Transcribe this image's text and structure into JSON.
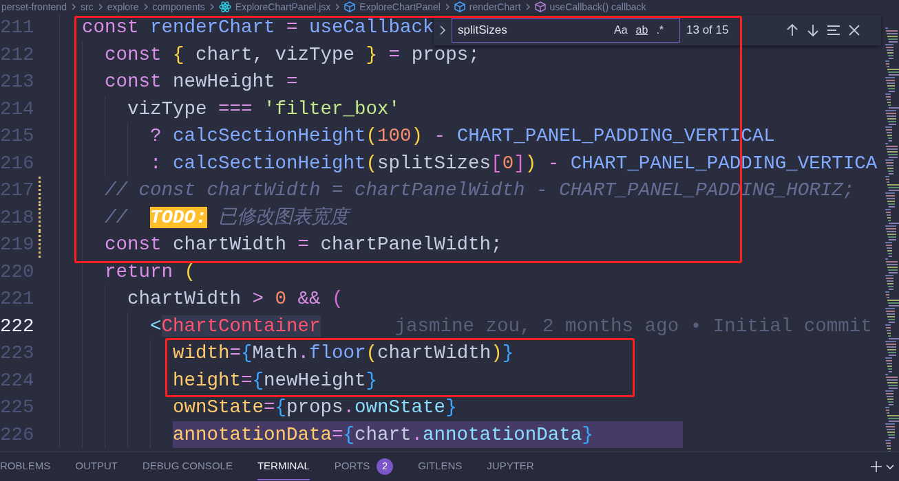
{
  "breadcrumbs": [
    {
      "label": "perset-frontend",
      "kind": "folder"
    },
    {
      "label": "src",
      "kind": "folder"
    },
    {
      "label": "explore",
      "kind": "folder"
    },
    {
      "label": "components",
      "kind": "folder"
    },
    {
      "label": "ExploreChartPanel.jsx",
      "kind": "file"
    },
    {
      "label": "ExploreChartPanel",
      "kind": "symbol"
    },
    {
      "label": "renderChart",
      "kind": "symbol"
    },
    {
      "label": "useCallback() callback",
      "kind": "method"
    }
  ],
  "find_widget": {
    "expanded": false,
    "value": "splitSizes",
    "options": [
      {
        "label": "Aa",
        "active": false
      },
      {
        "label": "ab",
        "active": false
      },
      {
        "label": ".*",
        "active": false
      }
    ],
    "result": "13 of 15"
  },
  "lines": [
    {
      "number": "211",
      "current": false,
      "modified": false,
      "selected": false,
      "tokens": [
        {
          "text": "  const ",
          "kind": "keyword"
        },
        {
          "text": "renderChart",
          "kind": "function"
        },
        {
          "text": " = ",
          "kind": "operator"
        },
        {
          "text": "useCallback",
          "kind": "function"
        }
      ]
    },
    {
      "number": "212",
      "current": false,
      "modified": false,
      "selected": false,
      "tokens": [
        {
          "text": "    const ",
          "kind": "keyword"
        },
        {
          "text": "{",
          "kind": "bracket1"
        },
        {
          "text": " chart, vizType ",
          "kind": "variable"
        },
        {
          "text": "}",
          "kind": "bracket1"
        },
        {
          "text": " = ",
          "kind": "operator"
        },
        {
          "text": "props;",
          "kind": "variable"
        }
      ]
    },
    {
      "number": "213",
      "current": false,
      "modified": false,
      "selected": false,
      "tokens": [
        {
          "text": "    const ",
          "kind": "keyword"
        },
        {
          "text": "newHeight",
          "kind": "variable"
        },
        {
          "text": " =",
          "kind": "operator"
        }
      ]
    },
    {
      "number": "214",
      "current": false,
      "modified": false,
      "selected": false,
      "tokens": [
        {
          "text": "      vizType",
          "kind": "variable"
        },
        {
          "text": " === ",
          "kind": "operator"
        },
        {
          "text": "'filter_box'",
          "kind": "string"
        }
      ]
    },
    {
      "number": "215",
      "current": false,
      "modified": false,
      "selected": false,
      "tokens": [
        {
          "text": "        ? ",
          "kind": "operator"
        },
        {
          "text": "calcSectionHeight",
          "kind": "function"
        },
        {
          "text": "(",
          "kind": "bracket1"
        },
        {
          "text": "100",
          "kind": "number"
        },
        {
          "text": ")",
          "kind": "bracket1"
        },
        {
          "text": " - ",
          "kind": "operator"
        },
        {
          "text": "CHART_PANEL_PADDING_VERTICAL",
          "kind": "constant"
        }
      ]
    },
    {
      "number": "216",
      "current": false,
      "modified": false,
      "selected": false,
      "tokens": [
        {
          "text": "        : ",
          "kind": "operator"
        },
        {
          "text": "calcSectionHeight",
          "kind": "function"
        },
        {
          "text": "(",
          "kind": "bracket1"
        },
        {
          "text": "splitSizes",
          "kind": "variable"
        },
        {
          "text": "[",
          "kind": "bracket2"
        },
        {
          "text": "0",
          "kind": "number"
        },
        {
          "text": "]",
          "kind": "bracket2"
        },
        {
          "text": ")",
          "kind": "bracket1"
        },
        {
          "text": " - ",
          "kind": "operator"
        },
        {
          "text": "CHART_PANEL_PADDING_VERTICA",
          "kind": "constant"
        }
      ]
    },
    {
      "number": "217",
      "current": false,
      "modified": true,
      "selected": false,
      "tokens": [
        {
          "text": "    // const chartWidth = chartPanelWidth - CHART_PANEL_PADDING_HORIZ;",
          "kind": "comment"
        }
      ]
    },
    {
      "number": "218",
      "current": false,
      "modified": true,
      "selected": false,
      "tokens": [
        {
          "text": "    //  ",
          "kind": "comment"
        },
        {
          "text": "TODO:",
          "kind": "todo"
        },
        {
          "text": " 已修改图表宽度",
          "kind": "comment"
        }
      ]
    },
    {
      "number": "219",
      "current": false,
      "modified": true,
      "selected": false,
      "tokens": [
        {
          "text": "    const ",
          "kind": "keyword"
        },
        {
          "text": "chartWidth",
          "kind": "variable"
        },
        {
          "text": " = ",
          "kind": "operator"
        },
        {
          "text": "chartPanelWidth;",
          "kind": "variable"
        }
      ]
    },
    {
      "number": "220",
      "current": false,
      "modified": false,
      "selected": false,
      "tokens": [
        {
          "text": "    return ",
          "kind": "keyword"
        },
        {
          "text": "(",
          "kind": "bracket1"
        }
      ]
    },
    {
      "number": "221",
      "current": false,
      "modified": false,
      "selected": false,
      "tokens": [
        {
          "text": "      chartWidth",
          "kind": "variable"
        },
        {
          "text": " > ",
          "kind": "operator"
        },
        {
          "text": "0",
          "kind": "number"
        },
        {
          "text": " && ",
          "kind": "operator"
        },
        {
          "text": "(",
          "kind": "bracket2"
        }
      ]
    },
    {
      "number": "222",
      "current": true,
      "modified": false,
      "selected": false,
      "tokens": [
        {
          "text": "        <",
          "kind": "jsx"
        },
        {
          "text": "ChartContainer",
          "kind": "tag"
        }
      ],
      "blame": "jasmine zou, 2 months ago • Initial commit"
    },
    {
      "number": "223",
      "current": false,
      "modified": false,
      "selected": false,
      "tokens": [
        {
          "text": "          width",
          "kind": "attribute"
        },
        {
          "text": "=",
          "kind": "operator"
        },
        {
          "text": "{",
          "kind": "bracket3"
        },
        {
          "text": "Math",
          "kind": "variable"
        },
        {
          "text": ".",
          "kind": "operator"
        },
        {
          "text": "floor",
          "kind": "function"
        },
        {
          "text": "(",
          "kind": "bracket1"
        },
        {
          "text": "chartWidth",
          "kind": "variable"
        },
        {
          "text": ")",
          "kind": "bracket1"
        },
        {
          "text": "}",
          "kind": "bracket3"
        }
      ]
    },
    {
      "number": "224",
      "current": false,
      "modified": false,
      "selected": false,
      "tokens": [
        {
          "text": "          height",
          "kind": "attribute"
        },
        {
          "text": "=",
          "kind": "operator"
        },
        {
          "text": "{",
          "kind": "bracket3"
        },
        {
          "text": "newHeight",
          "kind": "variable"
        },
        {
          "text": "}",
          "kind": "bracket3"
        }
      ]
    },
    {
      "number": "225",
      "current": false,
      "modified": false,
      "selected": false,
      "tokens": [
        {
          "text": "          ownState",
          "kind": "attribute"
        },
        {
          "text": "=",
          "kind": "operator"
        },
        {
          "text": "{",
          "kind": "bracket3"
        },
        {
          "text": "props",
          "kind": "variable"
        },
        {
          "text": ".",
          "kind": "operator"
        },
        {
          "text": "ownState",
          "kind": "property"
        },
        {
          "text": "}",
          "kind": "bracket3"
        }
      ]
    },
    {
      "number": "226",
      "current": false,
      "modified": false,
      "selected": true,
      "tokens": [
        {
          "text": "          annotationData",
          "kind": "attribute"
        },
        {
          "text": "=",
          "kind": "operator"
        },
        {
          "text": "{",
          "kind": "bracket3"
        },
        {
          "text": "chart",
          "kind": "variable"
        },
        {
          "text": ".",
          "kind": "operator"
        },
        {
          "text": "annotationData",
          "kind": "property"
        },
        {
          "text": "}",
          "kind": "bracket3"
        }
      ]
    }
  ],
  "panel_tabs": [
    {
      "label": "ROBLEMS",
      "selected": false
    },
    {
      "label": "OUTPUT",
      "selected": false
    },
    {
      "label": "DEBUG CONSOLE",
      "selected": false
    },
    {
      "label": "TERMINAL",
      "selected": true
    },
    {
      "label": "PORTS",
      "selected": false,
      "badge": "2"
    },
    {
      "label": "GITLENS",
      "selected": false
    },
    {
      "label": "JUPYTER",
      "selected": false
    }
  ]
}
